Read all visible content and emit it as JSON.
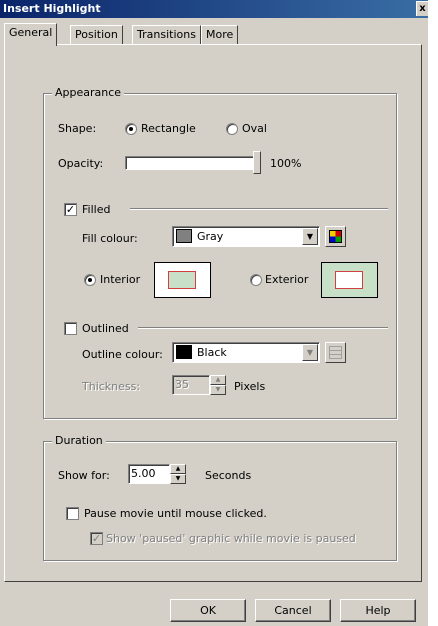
{
  "window": {
    "title": "Insert Highlight",
    "close_label": "x"
  },
  "tabs": [
    "General",
    "Position",
    "Transitions",
    "More"
  ],
  "appearance": {
    "legend": "Appearance",
    "shape_label": "Shape:",
    "shape_options": [
      "Rectangle",
      "Oval"
    ],
    "shape_selected": "Rectangle",
    "opacity_label": "Opacity:",
    "opacity_value": "100%",
    "opacity_fraction": 1.0,
    "filled_label": "Filled",
    "filled_checked": true,
    "fill_colour_label": "Fill colour:",
    "fill_colour_value": "Gray",
    "fill_colour_hex": "#808080",
    "interior_label": "Interior",
    "exterior_label": "Exterior",
    "fill_region_selected": "Interior",
    "outlined_label": "Outlined",
    "outlined_checked": false,
    "outline_colour_label": "Outline colour:",
    "outline_colour_value": "Black",
    "outline_colour_hex": "#000000",
    "thickness_label": "Thickness:",
    "thickness_value": "35",
    "thickness_unit": "Pixels"
  },
  "duration": {
    "legend": "Duration",
    "show_for_label": "Show for:",
    "show_for_value": "5.00",
    "show_for_unit": "Seconds",
    "pause_label": "Pause movie until mouse clicked.",
    "pause_checked": false,
    "show_paused_label": "Show 'paused' graphic while movie is paused",
    "show_paused_checked": true
  },
  "buttons": {
    "ok": "OK",
    "cancel": "Cancel",
    "help": "Help"
  },
  "colors": {
    "highlight_preview_fill": "#c8e0c8",
    "highlight_preview_border": "#d04040",
    "title_bar": "#0a246a"
  }
}
